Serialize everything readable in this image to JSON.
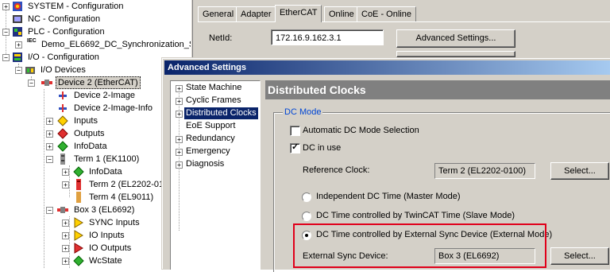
{
  "tree": {
    "items": [
      {
        "label": "SYSTEM - Configuration",
        "icon": "system-config-icon"
      },
      {
        "label": "NC - Configuration",
        "icon": "nc-config-icon"
      },
      {
        "label": "PLC - Configuration",
        "icon": "plc-config-icon"
      },
      {
        "label": "Demo_EL6692_DC_Synchronization_S",
        "icon": "iec-project-icon",
        "iconText": "IEC"
      },
      {
        "label": "I/O - Configuration",
        "icon": "io-config-icon"
      },
      {
        "label": "I/O Devices",
        "icon": "io-devices-icon"
      },
      {
        "label": "Device 2 (EtherCAT)",
        "icon": "ethercat-device-icon"
      },
      {
        "label": "Device 2-Image",
        "icon": "device-image-icon"
      },
      {
        "label": "Device 2-Image-Info",
        "icon": "device-image-info-icon"
      },
      {
        "label": "Inputs",
        "icon": "inputs-icon"
      },
      {
        "label": "Outputs",
        "icon": "outputs-icon"
      },
      {
        "label": "InfoData",
        "icon": "infodata-icon"
      },
      {
        "label": "Term 1 (EK1100)",
        "icon": "terminal-icon"
      },
      {
        "label": "InfoData",
        "icon": "infodata-icon"
      },
      {
        "label": "Term 2 (EL2202-01",
        "icon": "terminal-red-icon"
      },
      {
        "label": "Term 4 (EL9011)",
        "icon": "terminal-end-icon"
      },
      {
        "label": "Box 3 (EL6692)",
        "icon": "box-icon"
      },
      {
        "label": "SYNC Inputs",
        "icon": "sync-inputs-icon"
      },
      {
        "label": "IO Inputs",
        "icon": "io-inputs-icon"
      },
      {
        "label": "IO Outputs",
        "icon": "io-outputs-icon"
      },
      {
        "label": "WcState",
        "icon": "wcstate-icon"
      }
    ]
  },
  "tabs": [
    "General",
    "Adapter",
    "EtherCAT",
    "Online",
    "CoE - Online"
  ],
  "active_tab": "EtherCAT",
  "netid": {
    "label": "NetId:",
    "value": "172.16.9.162.3.1"
  },
  "advanced_button": "Advanced Settings...",
  "dialog": {
    "title": "Advanced Settings",
    "nav": [
      {
        "label": "State Machine",
        "expander": "+"
      },
      {
        "label": "Cyclic Frames",
        "expander": "+"
      },
      {
        "label": "Distributed Clocks",
        "expander": "+",
        "selected": true
      },
      {
        "label": "EoE Support",
        "expander": ""
      },
      {
        "label": "Redundancy",
        "expander": "+"
      },
      {
        "label": "Emergency",
        "expander": "+"
      },
      {
        "label": "Diagnosis",
        "expander": "+"
      }
    ],
    "header": "Distributed Clocks",
    "group_label": "DC Mode",
    "auto_dc": {
      "label": "Automatic DC Mode Selection",
      "checked": false
    },
    "dc_in_use": {
      "label": "DC in use",
      "checked": true
    },
    "reference_clock": {
      "label": "Reference Clock:",
      "value": "Term 2 (EL2202-0100)",
      "button": "Select..."
    },
    "modes": [
      {
        "label": "Independent DC Time (Master Mode)",
        "selected": false
      },
      {
        "label": "DC Time controlled by TwinCAT Time (Slave Mode)",
        "selected": false
      },
      {
        "label": "DC Time controlled by External Sync Device (External Mode)",
        "selected": true
      }
    ],
    "external_sync": {
      "label": "External Sync Device:",
      "value": "Box 3 (EL6692)",
      "button": "Select..."
    }
  },
  "colors": {
    "highlight": "#e0001a",
    "titlebar": "#0a246a",
    "group_label": "#0046d5"
  }
}
